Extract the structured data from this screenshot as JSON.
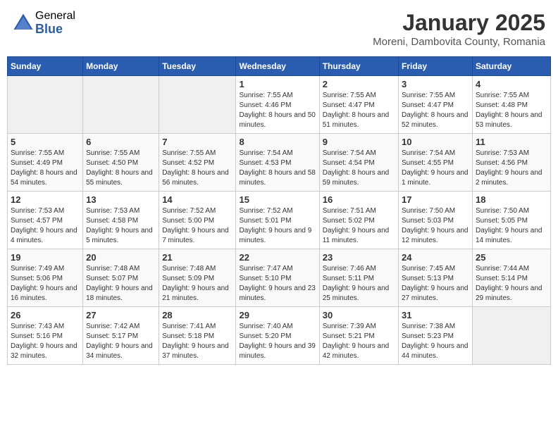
{
  "logo": {
    "general": "General",
    "blue": "Blue"
  },
  "header": {
    "title": "January 2025",
    "subtitle": "Moreni, Dambovita County, Romania"
  },
  "weekdays": [
    "Sunday",
    "Monday",
    "Tuesday",
    "Wednesday",
    "Thursday",
    "Friday",
    "Saturday"
  ],
  "weeks": [
    [
      {
        "day": "",
        "empty": true
      },
      {
        "day": "",
        "empty": true
      },
      {
        "day": "",
        "empty": true
      },
      {
        "day": "1",
        "sunrise": "7:55 AM",
        "sunset": "4:46 PM",
        "daylight": "8 hours and 50 minutes."
      },
      {
        "day": "2",
        "sunrise": "7:55 AM",
        "sunset": "4:47 PM",
        "daylight": "8 hours and 51 minutes."
      },
      {
        "day": "3",
        "sunrise": "7:55 AM",
        "sunset": "4:47 PM",
        "daylight": "8 hours and 52 minutes."
      },
      {
        "day": "4",
        "sunrise": "7:55 AM",
        "sunset": "4:48 PM",
        "daylight": "8 hours and 53 minutes."
      }
    ],
    [
      {
        "day": "5",
        "sunrise": "7:55 AM",
        "sunset": "4:49 PM",
        "daylight": "8 hours and 54 minutes."
      },
      {
        "day": "6",
        "sunrise": "7:55 AM",
        "sunset": "4:50 PM",
        "daylight": "8 hours and 55 minutes."
      },
      {
        "day": "7",
        "sunrise": "7:55 AM",
        "sunset": "4:52 PM",
        "daylight": "8 hours and 56 minutes."
      },
      {
        "day": "8",
        "sunrise": "7:54 AM",
        "sunset": "4:53 PM",
        "daylight": "8 hours and 58 minutes."
      },
      {
        "day": "9",
        "sunrise": "7:54 AM",
        "sunset": "4:54 PM",
        "daylight": "8 hours and 59 minutes."
      },
      {
        "day": "10",
        "sunrise": "7:54 AM",
        "sunset": "4:55 PM",
        "daylight": "9 hours and 1 minute."
      },
      {
        "day": "11",
        "sunrise": "7:53 AM",
        "sunset": "4:56 PM",
        "daylight": "9 hours and 2 minutes."
      }
    ],
    [
      {
        "day": "12",
        "sunrise": "7:53 AM",
        "sunset": "4:57 PM",
        "daylight": "9 hours and 4 minutes."
      },
      {
        "day": "13",
        "sunrise": "7:53 AM",
        "sunset": "4:58 PM",
        "daylight": "9 hours and 5 minutes."
      },
      {
        "day": "14",
        "sunrise": "7:52 AM",
        "sunset": "5:00 PM",
        "daylight": "9 hours and 7 minutes."
      },
      {
        "day": "15",
        "sunrise": "7:52 AM",
        "sunset": "5:01 PM",
        "daylight": "9 hours and 9 minutes."
      },
      {
        "day": "16",
        "sunrise": "7:51 AM",
        "sunset": "5:02 PM",
        "daylight": "9 hours and 11 minutes."
      },
      {
        "day": "17",
        "sunrise": "7:50 AM",
        "sunset": "5:03 PM",
        "daylight": "9 hours and 12 minutes."
      },
      {
        "day": "18",
        "sunrise": "7:50 AM",
        "sunset": "5:05 PM",
        "daylight": "9 hours and 14 minutes."
      }
    ],
    [
      {
        "day": "19",
        "sunrise": "7:49 AM",
        "sunset": "5:06 PM",
        "daylight": "9 hours and 16 minutes."
      },
      {
        "day": "20",
        "sunrise": "7:48 AM",
        "sunset": "5:07 PM",
        "daylight": "9 hours and 18 minutes."
      },
      {
        "day": "21",
        "sunrise": "7:48 AM",
        "sunset": "5:09 PM",
        "daylight": "9 hours and 21 minutes."
      },
      {
        "day": "22",
        "sunrise": "7:47 AM",
        "sunset": "5:10 PM",
        "daylight": "9 hours and 23 minutes."
      },
      {
        "day": "23",
        "sunrise": "7:46 AM",
        "sunset": "5:11 PM",
        "daylight": "9 hours and 25 minutes."
      },
      {
        "day": "24",
        "sunrise": "7:45 AM",
        "sunset": "5:13 PM",
        "daylight": "9 hours and 27 minutes."
      },
      {
        "day": "25",
        "sunrise": "7:44 AM",
        "sunset": "5:14 PM",
        "daylight": "9 hours and 29 minutes."
      }
    ],
    [
      {
        "day": "26",
        "sunrise": "7:43 AM",
        "sunset": "5:16 PM",
        "daylight": "9 hours and 32 minutes."
      },
      {
        "day": "27",
        "sunrise": "7:42 AM",
        "sunset": "5:17 PM",
        "daylight": "9 hours and 34 minutes."
      },
      {
        "day": "28",
        "sunrise": "7:41 AM",
        "sunset": "5:18 PM",
        "daylight": "9 hours and 37 minutes."
      },
      {
        "day": "29",
        "sunrise": "7:40 AM",
        "sunset": "5:20 PM",
        "daylight": "9 hours and 39 minutes."
      },
      {
        "day": "30",
        "sunrise": "7:39 AM",
        "sunset": "5:21 PM",
        "daylight": "9 hours and 42 minutes."
      },
      {
        "day": "31",
        "sunrise": "7:38 AM",
        "sunset": "5:23 PM",
        "daylight": "9 hours and 44 minutes."
      },
      {
        "day": "",
        "empty": true
      }
    ]
  ]
}
